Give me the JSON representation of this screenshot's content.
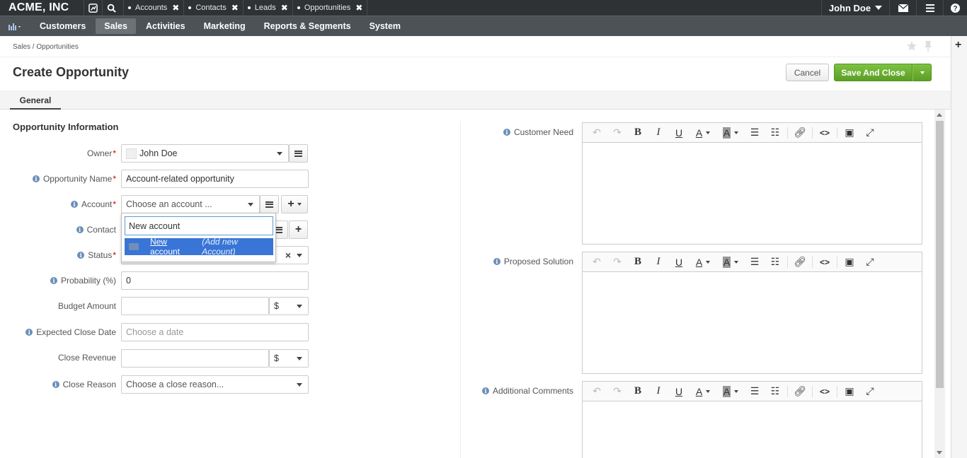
{
  "topbar": {
    "brand": "ACME, INC",
    "tabs": [
      {
        "label": "Accounts"
      },
      {
        "label": "Contacts"
      },
      {
        "label": "Leads"
      },
      {
        "label": "Opportunities"
      }
    ],
    "user": "John Doe"
  },
  "nav": {
    "items": [
      {
        "label": "Customers",
        "active": false
      },
      {
        "label": "Sales",
        "active": true
      },
      {
        "label": "Activities",
        "active": false
      },
      {
        "label": "Marketing",
        "active": false
      },
      {
        "label": "Reports & Segments",
        "active": false
      },
      {
        "label": "System",
        "active": false
      }
    ]
  },
  "breadcrumb": "Sales / Opportunities",
  "page_title": "Create Opportunity",
  "buttons": {
    "cancel": "Cancel",
    "save": "Save And Close"
  },
  "tab_general": "General",
  "section_title": "Opportunity Information",
  "form": {
    "owner": {
      "label": "Owner",
      "value": "John Doe"
    },
    "opportunity_name": {
      "label": "Opportunity Name",
      "value": "Account-related opportunity"
    },
    "account": {
      "label": "Account",
      "placeholder": "Choose an account ..."
    },
    "contact": {
      "label": "Contact"
    },
    "status": {
      "label": "Status",
      "clear": "×"
    },
    "probability": {
      "label": "Probability (%)",
      "value": "0"
    },
    "budget_amount": {
      "label": "Budget Amount",
      "currency": "$"
    },
    "expected_close_date": {
      "label": "Expected Close Date",
      "placeholder": "Choose a date"
    },
    "close_revenue": {
      "label": "Close Revenue",
      "currency": "$"
    },
    "close_reason": {
      "label": "Close Reason",
      "placeholder": "Choose a close reason..."
    }
  },
  "account_dropdown": {
    "search_value": "New account",
    "option_main": "New account",
    "option_hint": "(Add new Account)"
  },
  "editors": [
    {
      "label": "Customer Need"
    },
    {
      "label": "Proposed Solution"
    },
    {
      "label": "Additional Comments"
    }
  ],
  "colors": {
    "save_green": "#6cb033",
    "highlight_blue": "#3875d7",
    "topbar": "#2f3235",
    "nav": "#4c5255"
  }
}
